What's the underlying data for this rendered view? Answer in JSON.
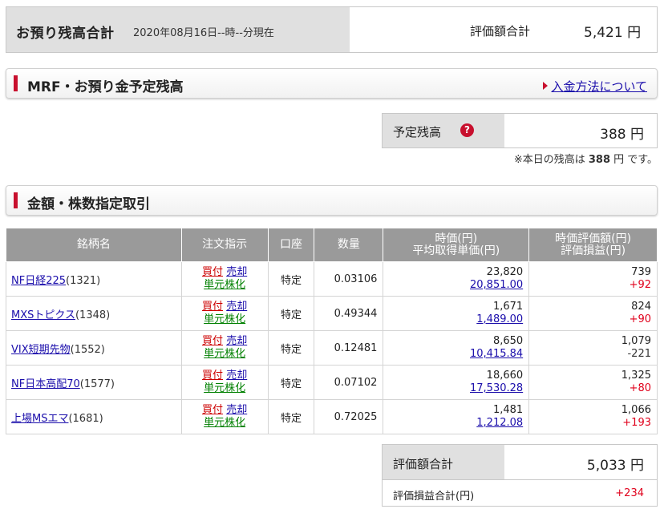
{
  "summary": {
    "title": "お預り残高合計",
    "as_of": "2020年08月16日--時--分現在",
    "eval_label": "評価額合計",
    "eval_value": "5,421 円"
  },
  "mrf_section": {
    "title": "MRF・お預り金予定残高",
    "link": "入金方法について",
    "scheduled_label": "予定残高",
    "scheduled_value": "388 円",
    "note_prefix": "※本日の残高は",
    "note_amount": "388",
    "note_suffix": "円 です。"
  },
  "trade_section": {
    "title": "金額・株数指定取引"
  },
  "table": {
    "headers": {
      "name": "銘柄名",
      "order": "注文指示",
      "account": "口座",
      "quantity": "数量",
      "price_line1": "時価(円)",
      "price_line2": "平均取得単価(円)",
      "eval_line1": "時価評価額(円)",
      "eval_line2": "評価損益(円)"
    },
    "actions": {
      "buy": "買付",
      "sell": "売却",
      "unit": "単元株化"
    },
    "rows": [
      {
        "name": "NF日経225",
        "code": "(1321)",
        "account": "特定",
        "quantity": "0.03106",
        "price": "23,820",
        "avg_cost": "20,851.00",
        "market_value": "739",
        "pl": "+92",
        "pl_sign": "pos"
      },
      {
        "name": "MXSトピクス",
        "code": "(1348)",
        "account": "特定",
        "quantity": "0.49344",
        "price": "1,671",
        "avg_cost": "1,489.00",
        "market_value": "824",
        "pl": "+90",
        "pl_sign": "pos"
      },
      {
        "name": "VIX短期先物",
        "code": "(1552)",
        "account": "特定",
        "quantity": "0.12481",
        "price": "8,650",
        "avg_cost": "10,415.84",
        "market_value": "1,079",
        "pl": "-221",
        "pl_sign": "neg"
      },
      {
        "name": "NF日本高配70",
        "code": "(1577)",
        "account": "特定",
        "quantity": "0.07102",
        "price": "18,660",
        "avg_cost": "17,530.28",
        "market_value": "1,325",
        "pl": "+80",
        "pl_sign": "pos"
      },
      {
        "name": "上場MSエマ",
        "code": "(1681)",
        "account": "特定",
        "quantity": "0.72025",
        "price": "1,481",
        "avg_cost": "1,212.08",
        "market_value": "1,066",
        "pl": "+193",
        "pl_sign": "pos"
      }
    ]
  },
  "totals": {
    "eval_label": "評価額合計",
    "eval_value": "5,033 円",
    "pl_label": "評価損益合計(円)",
    "pl_value": "+234"
  },
  "colors": {
    "accent_red": "#c8102e",
    "header_gray": "#9a9a9a",
    "label_gray": "#e0e0e0",
    "link_blue": "#1a0dab",
    "gain_red": "#e0001b",
    "unit_green": "#008000"
  },
  "icons": {
    "help": "question-circle-icon",
    "link_arrow": "triangle-right-icon"
  }
}
